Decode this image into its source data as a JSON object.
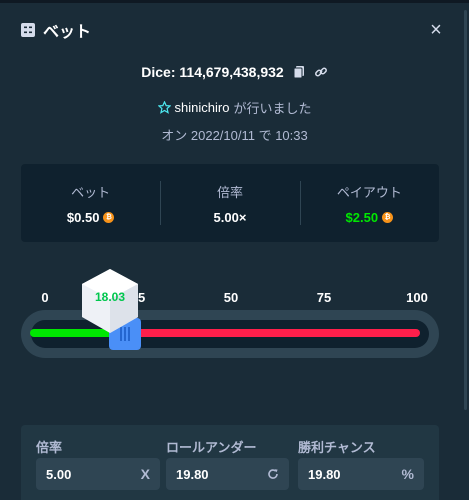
{
  "header": {
    "title": "ベット",
    "icon": "bet-list-icon",
    "close_icon": "close-icon"
  },
  "close_label": "×",
  "bet": {
    "dice_label": "Dice: 114,679,438,932",
    "user": "shinichiro",
    "user_suffix": "が行いました",
    "date_line": "オン 2022/10/11 で 10:33"
  },
  "summary": {
    "bet_label": "ベット",
    "bet_value": "$0.50",
    "multiplier_label": "倍率",
    "multiplier_value": "5.00×",
    "payout_label": "ペイアウト",
    "payout_value": "$2.50",
    "payout_color": "#00e701",
    "coin_icon": "bitcoin-icon"
  },
  "slider": {
    "ticks": [
      "0",
      "25",
      "50",
      "75",
      "100"
    ],
    "result": "18.03",
    "roll_under": 19.8,
    "win_color": "#00e701",
    "lose_color": "#ff1f4b"
  },
  "fields": {
    "multiplier_label": "倍率",
    "multiplier_value": "5.00",
    "multiplier_suffix": "X",
    "rollunder_label": "ロールアンダー",
    "rollunder_value": "19.80",
    "winchance_label": "勝利チャンス",
    "winchance_value": "19.80",
    "winchance_suffix": "%"
  }
}
